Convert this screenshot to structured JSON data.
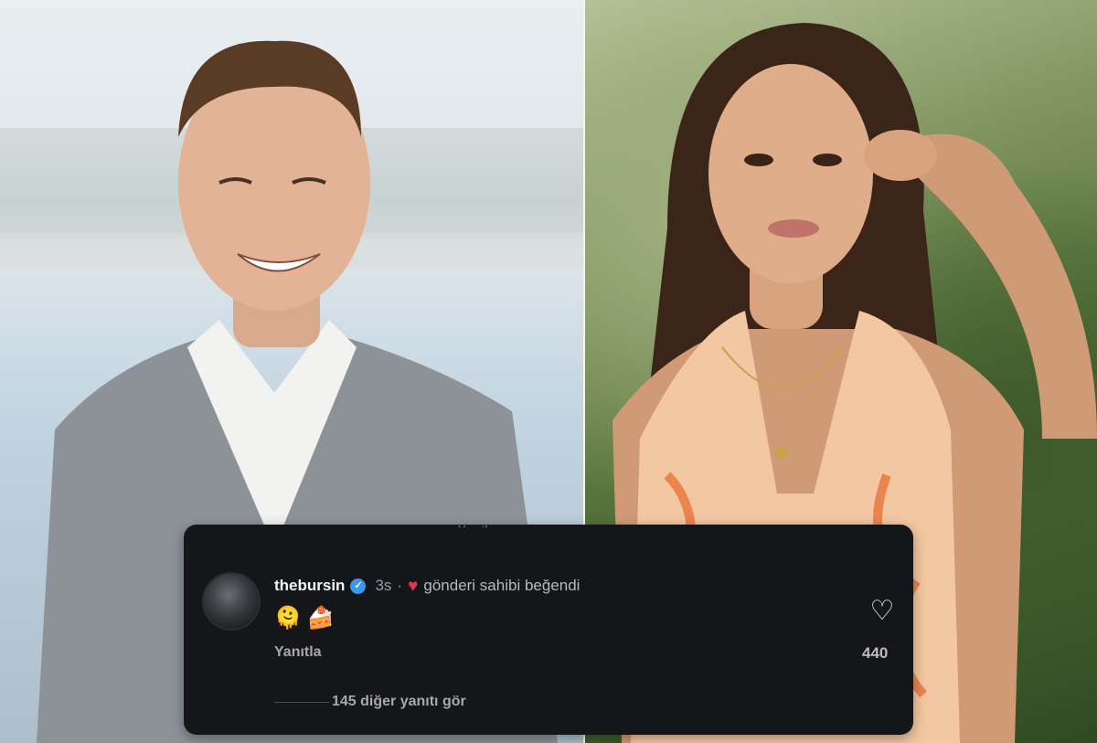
{
  "photos": {
    "left": {
      "description_icon": "photo-man-icon"
    },
    "right": {
      "description_icon": "photo-woman-icon"
    }
  },
  "comment": {
    "username": "thebursin",
    "verified_icon": "verified-badge-icon",
    "time": "3s",
    "separator": "·",
    "liked_by_author_icon": "heart-filled-icon",
    "liked_by_author_text": "gönderi sahibi beğendi",
    "emojis": [
      "🫠",
      "🍰"
    ],
    "reply_label": "Yanıtla",
    "like_icon": "heart-outline-icon",
    "like_count": "440",
    "view_more_replies": "145 diğer yanıtı gör",
    "cut_off_text": "Yanıtla"
  },
  "colors": {
    "card_bg": "#15161a",
    "verified": "#3897f0",
    "heart": "#e8334a"
  }
}
